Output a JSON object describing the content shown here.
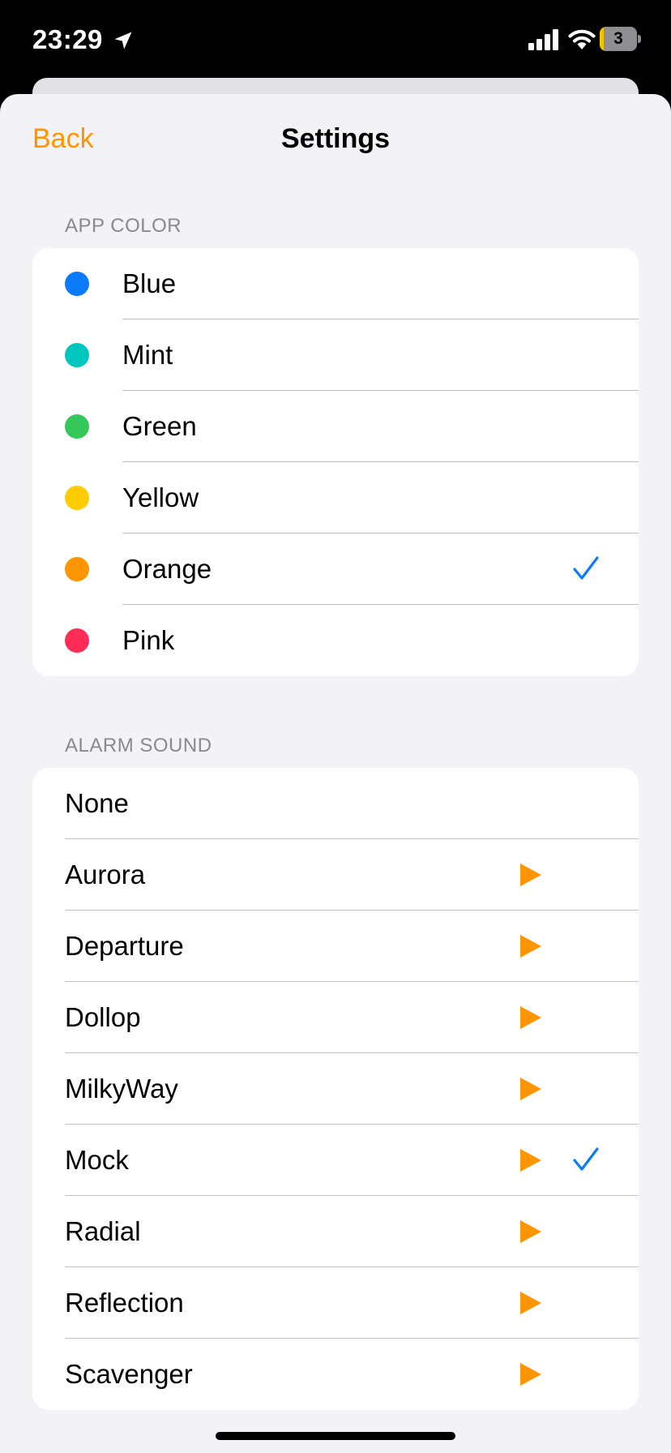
{
  "status_bar": {
    "time": "23:29",
    "battery_level": "3",
    "battery_fraction": 0.1,
    "icons": [
      "location-arrow-icon",
      "cellular-signal-icon",
      "wifi-icon",
      "battery-icon"
    ]
  },
  "nav": {
    "back_label": "Back",
    "title": "Settings"
  },
  "app_color": {
    "header": "APP COLOR",
    "selected": "Orange",
    "items": [
      {
        "label": "Blue",
        "color": "#0a7aff",
        "checked": false
      },
      {
        "label": "Mint",
        "color": "#00c7be",
        "checked": false
      },
      {
        "label": "Green",
        "color": "#34c759",
        "checked": false
      },
      {
        "label": "Yellow",
        "color": "#ffcc00",
        "checked": false
      },
      {
        "label": "Orange",
        "color": "#ff9500",
        "checked": true
      },
      {
        "label": "Pink",
        "color": "#ff2d55",
        "checked": false
      }
    ]
  },
  "alarm_sound": {
    "header": "ALARM SOUND",
    "selected": "Mock",
    "items": [
      {
        "label": "None",
        "playable": false,
        "checked": false
      },
      {
        "label": "Aurora",
        "playable": true,
        "checked": false
      },
      {
        "label": "Departure",
        "playable": true,
        "checked": false
      },
      {
        "label": "Dollop",
        "playable": true,
        "checked": false
      },
      {
        "label": "MilkyWay",
        "playable": true,
        "checked": false
      },
      {
        "label": "Mock",
        "playable": true,
        "checked": true
      },
      {
        "label": "Radial",
        "playable": true,
        "checked": false
      },
      {
        "label": "Reflection",
        "playable": true,
        "checked": false
      },
      {
        "label": "Scavenger",
        "playable": true,
        "checked": false
      }
    ]
  },
  "colors": {
    "accent": "#ff9500",
    "check": "#0a7aff",
    "background": "#f2f2f7",
    "separator": "#c6c6c8",
    "header_text": "#8a8a8e"
  }
}
